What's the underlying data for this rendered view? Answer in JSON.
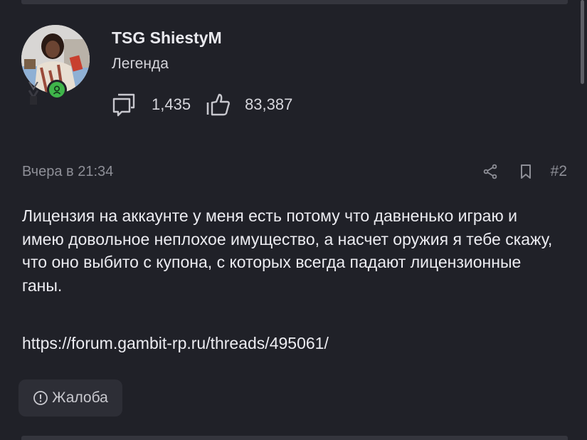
{
  "user": {
    "name": "TSG ShiestyM",
    "title": "Легенда",
    "messages_count": "1,435",
    "reactions_count": "83,387",
    "status_color": "#3fb54a"
  },
  "post": {
    "date": "Вчера в 21:34",
    "number": "#2",
    "text": "Лицензия на аккаунте у меня есть потому что давненько играю и имею довольное неплохое имущество, а насчет оружия я тебе скажу, что оно выбито с купона, с которых всегда падают лицензионные ганы.",
    "link": "https://forum.gambit-rp.ru/threads/495061/",
    "report_label": "Жалоба"
  },
  "icons": {
    "messages": "speech-bubble-icon",
    "reactions": "thumbs-up-icon",
    "share": "share-icon",
    "bookmark": "bookmark-icon",
    "report": "info-circle-icon",
    "status": "online-status-icon"
  }
}
